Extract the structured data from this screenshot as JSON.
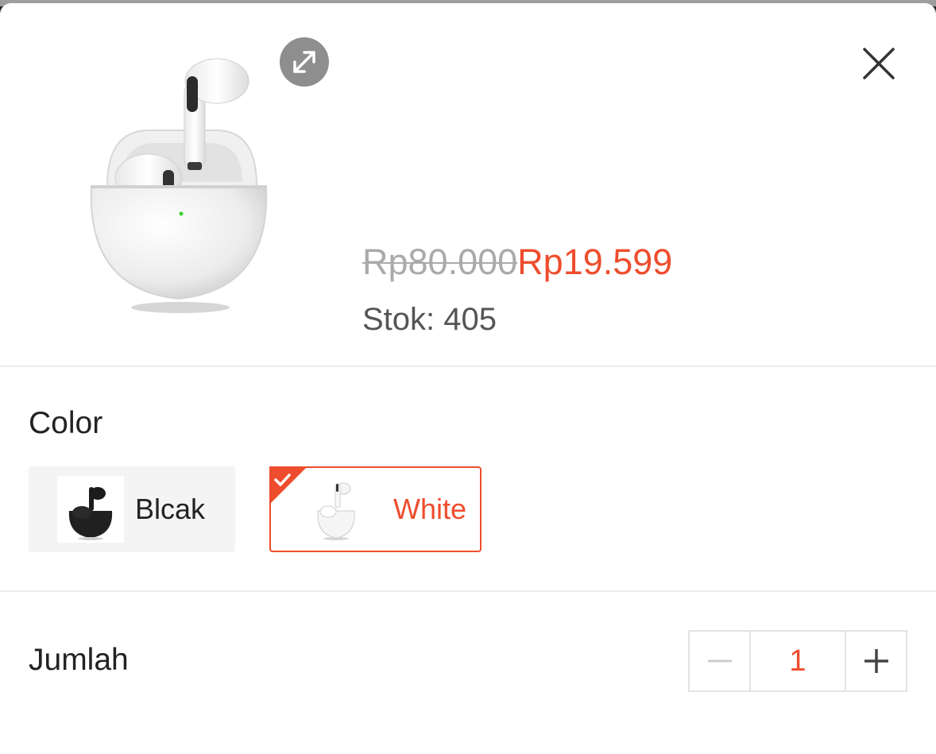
{
  "product": {
    "image_icon": "white-earbuds-case-image",
    "expand_icon": "expand-icon",
    "close_icon": "close-icon",
    "price_original": "Rp80.000",
    "price_sale": "Rp19.599",
    "stock": "Stok: 405"
  },
  "color_section": {
    "label": "Color",
    "options": [
      {
        "label": "Blcak",
        "thumb_icon": "black-earbuds-thumb",
        "selected": false
      },
      {
        "label": "White",
        "thumb_icon": "white-earbuds-thumb",
        "selected": true
      }
    ]
  },
  "quantity": {
    "label": "Jumlah",
    "decrement_icon": "minus-icon",
    "increment_icon": "plus-icon",
    "value": "1"
  },
  "colors": {
    "accent": "#ee4d2d",
    "muted_text": "#aaaaaa",
    "border": "#e3e3e3"
  }
}
